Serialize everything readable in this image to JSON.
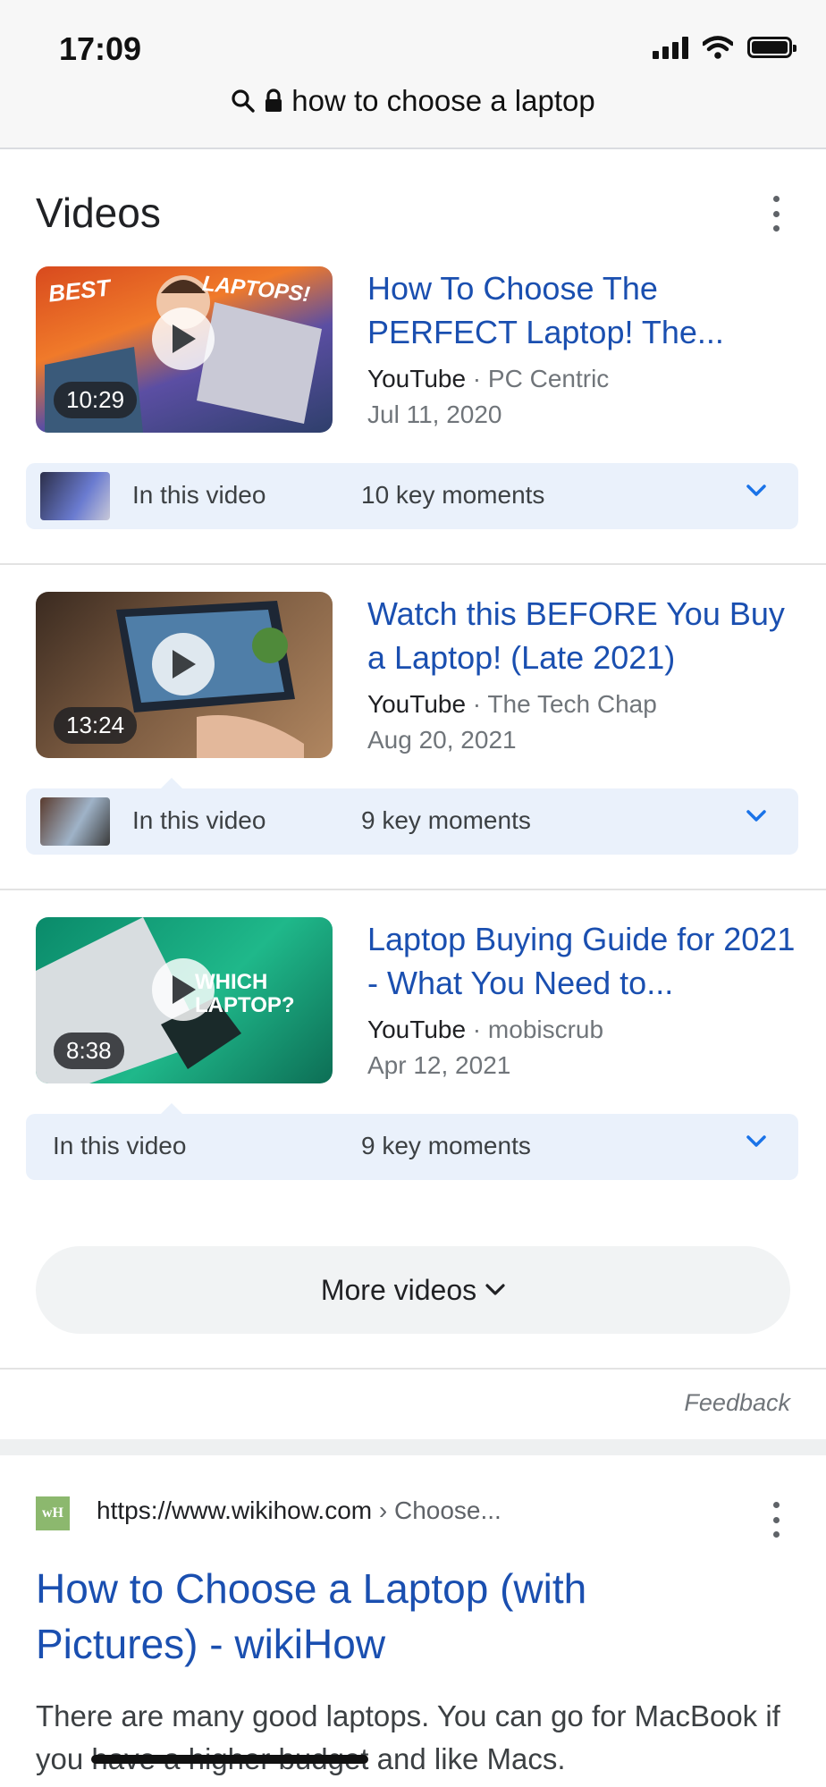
{
  "status_bar": {
    "time": "17:09"
  },
  "address_bar": {
    "query": "how to choose a laptop"
  },
  "videos": {
    "title": "Videos",
    "items": [
      {
        "title": "How To Choose The PERFECT Laptop! The...",
        "source": "YouTube",
        "separator": " · ",
        "channel": "PC Centric",
        "date": "Jul 11, 2020",
        "duration": "10:29",
        "thumb_text_left": "BEST",
        "thumb_text_right": "LAPTOPS!",
        "moments_label": "In this video",
        "moments_count": "10 key moments"
      },
      {
        "title": "Watch this BEFORE You Buy a Laptop! (Late 2021)",
        "source": "YouTube",
        "separator": " · ",
        "channel": "The Tech Chap",
        "date": "Aug 20, 2021",
        "duration": "13:24",
        "moments_label": "In this video",
        "moments_count": "9 key moments"
      },
      {
        "title": "Laptop Buying Guide for 2021 - What You Need to...",
        "source": "YouTube",
        "separator": " · ",
        "channel": "mobiscrub",
        "date": "Apr 12, 2021",
        "duration": "8:38",
        "thumb_text": "WHICH LAPTOP?",
        "moments_label": "In this video",
        "moments_count": "9 key moments"
      }
    ],
    "more_label": "More videos",
    "feedback_label": "Feedback"
  },
  "result": {
    "favicon_text": "wH",
    "url": "https://www.wikihow.com",
    "breadcrumb": " › Choose...",
    "title": "How to Choose a Laptop (with Pictures) - wikiHow",
    "snippet_start": "There are many good laptops. You can go for MacBook if you ",
    "snippet_redacted": "have a higher budget",
    "snippet_end": " and like Macs."
  },
  "colors": {
    "link": "#1a4fb0",
    "moments_bg": "#eaf1fb",
    "chevron": "#1a73e8"
  }
}
